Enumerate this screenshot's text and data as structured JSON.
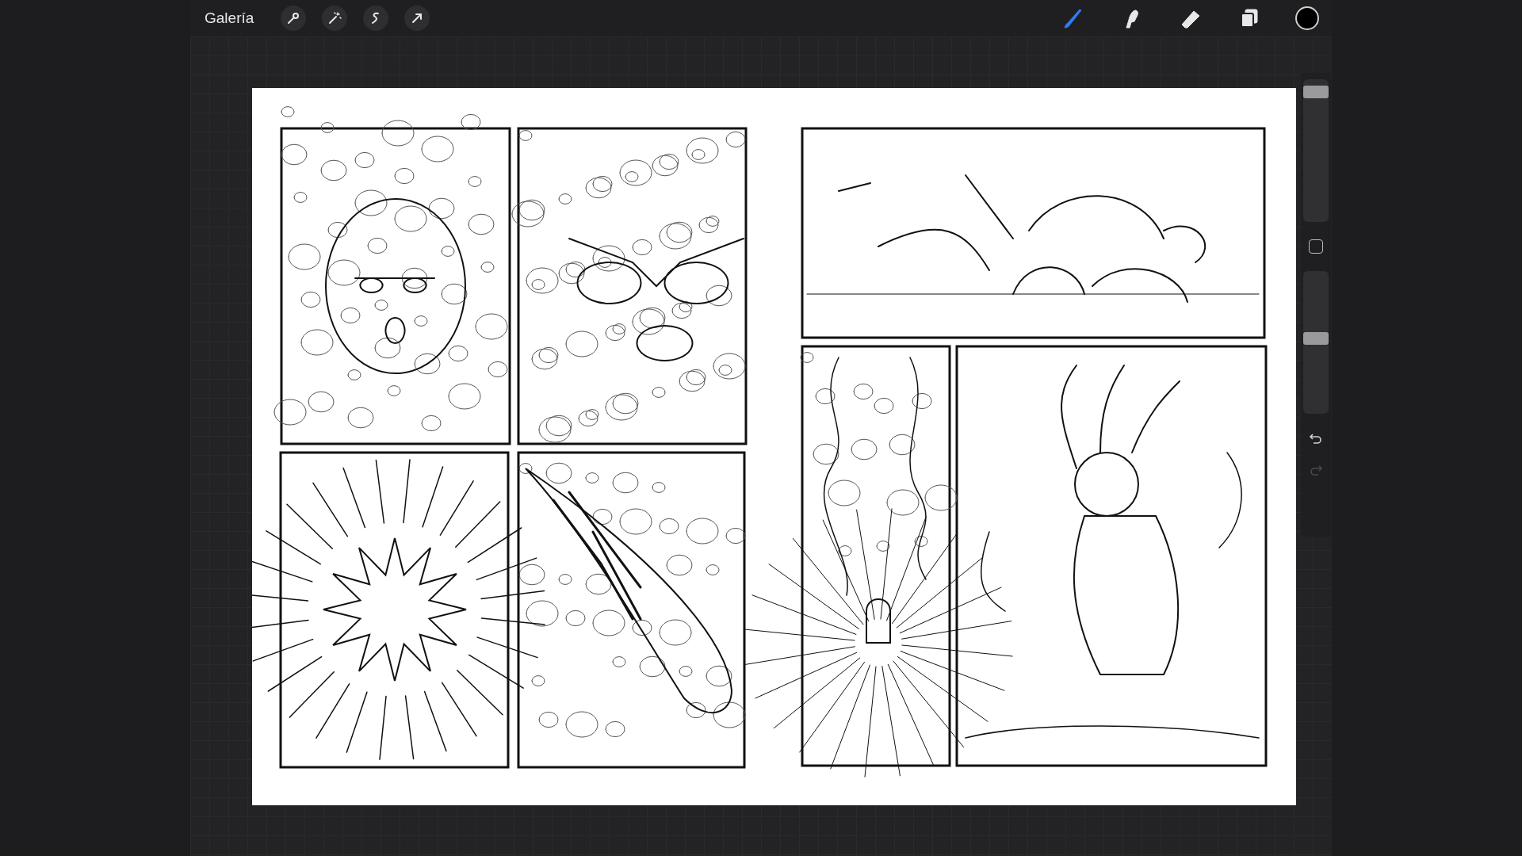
{
  "toolbar": {
    "gallery_label": "Galería",
    "actions": [
      {
        "kind": "wrench"
      },
      {
        "kind": "wand"
      },
      {
        "kind": "selection"
      },
      {
        "kind": "transform"
      }
    ],
    "tools": [
      {
        "kind": "brush",
        "selected": true
      },
      {
        "kind": "smudge",
        "selected": false
      },
      {
        "kind": "eraser",
        "selected": false
      },
      {
        "kind": "layers",
        "selected": false
      }
    ],
    "color": "#000000"
  },
  "sidebar": {
    "size_slider": {
      "level": 0.95
    },
    "opacity_slider": {
      "level": 0.53
    },
    "undo": {
      "disabled": false
    },
    "redo": {
      "disabled": true
    }
  }
}
